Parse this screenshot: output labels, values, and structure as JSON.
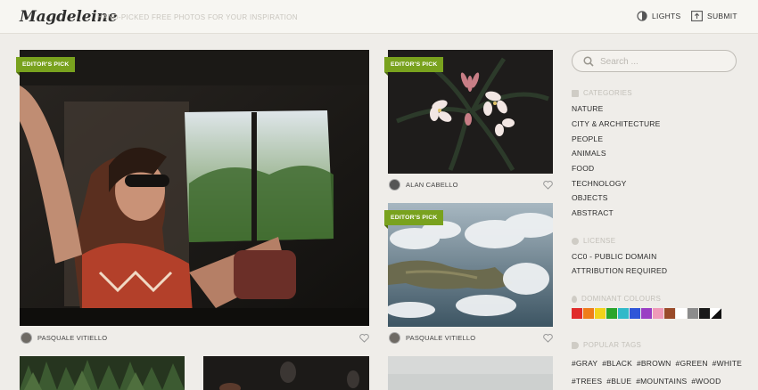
{
  "header": {
    "logo": "Magdeleine",
    "tagline": "HAND-PICKED FREE PHOTOS FOR YOUR INSPIRATION",
    "lights_label": "LIGHTS",
    "submit_label": "SUBMIT"
  },
  "photos": [
    {
      "badge": "EDITOR'S PICK",
      "author": "PASQUALE VITIELLO"
    },
    {
      "badge": "EDITOR'S PICK",
      "author": "ALAN CABELLO"
    },
    {
      "badge": "EDITOR'S PICK",
      "author": "PASQUALE VITIELLO"
    }
  ],
  "search": {
    "placeholder": "Search ..."
  },
  "sidebar": {
    "categories_heading": "CATEGORIES",
    "categories": [
      "NATURE",
      "CITY & ARCHITECTURE",
      "PEOPLE",
      "ANIMALS",
      "FOOD",
      "TECHNOLOGY",
      "OBJECTS",
      "ABSTRACT"
    ],
    "license_heading": "LICENSE",
    "licenses": [
      "CC0 - PUBLIC DOMAIN",
      "ATTRIBUTION REQUIRED"
    ],
    "colours_heading": "DOMINANT COLOURS",
    "colours": [
      "#e02b2b",
      "#ef7d1a",
      "#f2d21a",
      "#2aa52a",
      "#31b9c9",
      "#2f56d8",
      "#9a3fc4",
      "#ef9ab8",
      "#9a4b2a",
      "#ffffff",
      "#8c8c8c",
      "#1a1a1a",
      "split-black-white"
    ],
    "tags_heading": "POPULAR TAGS",
    "tags_row1": [
      "#GRAY",
      "#BLACK",
      "#BROWN",
      "#GREEN",
      "#WHITE"
    ],
    "tags_row2": [
      "#TREES",
      "#BLUE",
      "#MOUNTAINS",
      "#WOOD"
    ]
  },
  "colors": {
    "accent": "#79a21e",
    "background": "#efede9"
  }
}
